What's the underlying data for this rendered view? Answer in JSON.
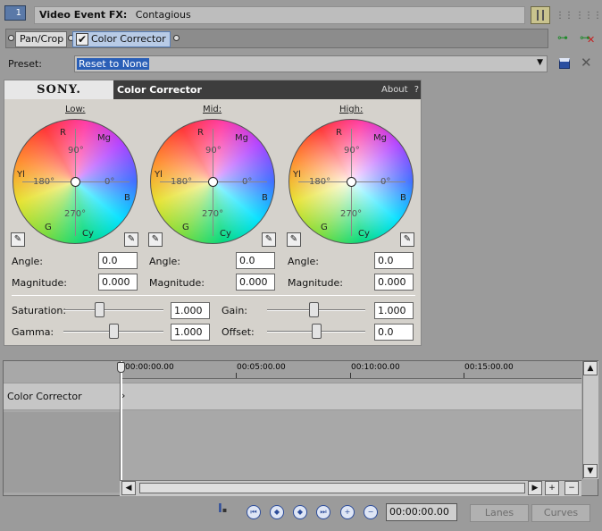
{
  "header": {
    "event_number": "1",
    "title_label": "Video Event FX:",
    "title_value": "Contagious"
  },
  "chain": {
    "items": [
      {
        "label": "Pan/Crop",
        "selected": false
      },
      {
        "label": "Color Corrector",
        "selected": true,
        "enabled": true
      }
    ]
  },
  "preset": {
    "label": "Preset:",
    "value": "Reset to None"
  },
  "plugin": {
    "brand": "SONY.",
    "name": "Color Corrector",
    "about": "About",
    "help": "?"
  },
  "wheels": [
    {
      "title": "Low:",
      "angle": "0.0",
      "magnitude": "0.000"
    },
    {
      "title": "Mid:",
      "angle": "0.0",
      "magnitude": "0.000"
    },
    {
      "title": "High:",
      "angle": "0.0",
      "magnitude": "0.000"
    }
  ],
  "wheel_labels": {
    "r": "R",
    "mg": "Mg",
    "yl": "Yl",
    "b": "B",
    "g": "G",
    "cy": "Cy",
    "d90": "90°",
    "d180": "180°",
    "d0": "0°",
    "d270": "270°"
  },
  "field_labels": {
    "angle": "Angle:",
    "magnitude": "Magnitude:"
  },
  "sliders": {
    "saturation": {
      "label": "Saturation:",
      "value": "1.000",
      "level": 0.35
    },
    "gamma": {
      "label": "Gamma:",
      "value": "1.000",
      "level": 0.5
    },
    "gain": {
      "label": "Gain:",
      "value": "1.000",
      "level": 0.47
    },
    "offset": {
      "label": "Offset:",
      "value": "0.0",
      "level": 0.5
    }
  },
  "timeline": {
    "ticks": [
      "00:00:00.00",
      "00:05:00.00",
      "00:10:00.00",
      "00:15:00.00"
    ],
    "track_label": "Color Corrector"
  },
  "transport": {
    "timecode": "00:00:00.00",
    "lanes": "Lanes",
    "curves": "Curves"
  }
}
